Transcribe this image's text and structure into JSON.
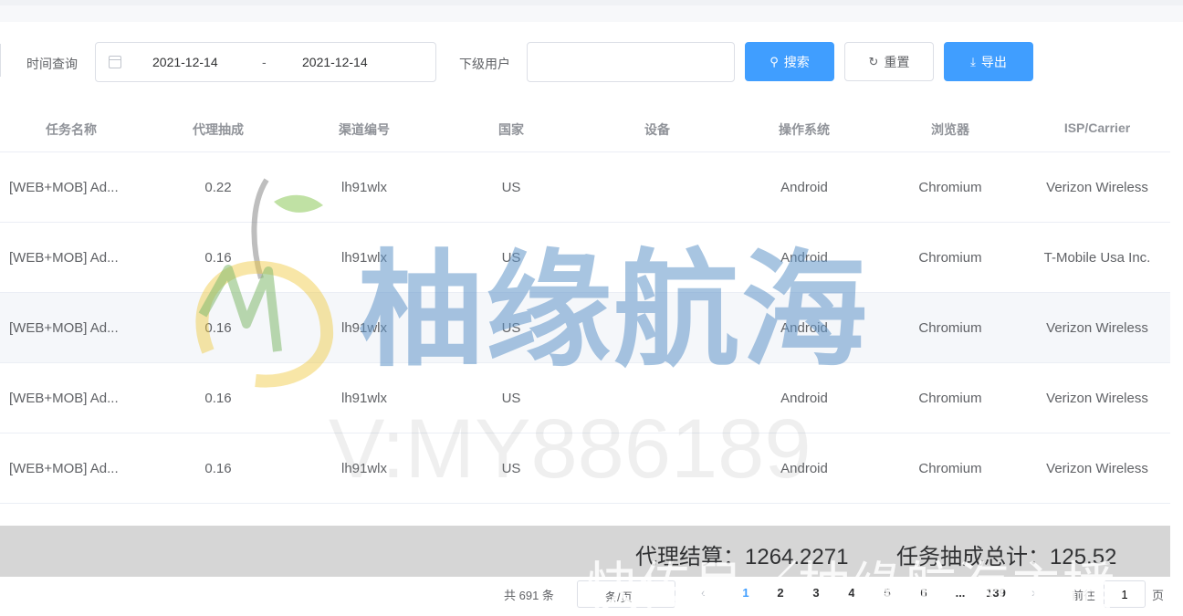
{
  "filters": {
    "time_label": "时间查询",
    "date_start": "2021-12-14",
    "date_sep": "-",
    "date_end": "2021-12-14",
    "subuser_label": "下级用户",
    "subuser_value": "",
    "search_label": "搜索",
    "reset_label": "重置",
    "export_label": "导出"
  },
  "table": {
    "columns": [
      "任务名称",
      "代理抽成",
      "渠道编号",
      "国家",
      "设备",
      "操作系统",
      "浏览器",
      "ISP/Carrier"
    ],
    "rows": [
      [
        "[WEB+MOB] Ad...",
        "0.22",
        "lh91wlx",
        "US",
        "",
        "Android",
        "Chromium",
        "Verizon Wireless"
      ],
      [
        "[WEB+MOB] Ad...",
        "0.16",
        "lh91wlx",
        "US",
        "",
        "Android",
        "Chromium",
        "T-Mobile Usa Inc."
      ],
      [
        "[WEB+MOB] Ad...",
        "0.16",
        "lh91wlx",
        "US",
        "",
        "Android",
        "Chromium",
        "Verizon Wireless"
      ],
      [
        "[WEB+MOB] Ad...",
        "0.16",
        "lh91wlx",
        "US",
        "",
        "Android",
        "Chromium",
        "Verizon Wireless"
      ],
      [
        "[WEB+MOB] Ad...",
        "0.16",
        "lh91wlx",
        "US",
        "",
        "Android",
        "Chromium",
        "Verizon Wireless"
      ]
    ]
  },
  "summary": {
    "agent_settlement": "代理结算：1264.2271",
    "task_commission_total": "任务抽成总计：125.52"
  },
  "pager": {
    "total": "共 691 条",
    "page_size": "条/页",
    "pages": [
      "1",
      "2",
      "3",
      "4",
      "5",
      "6",
      "...",
      "139"
    ],
    "active_page": "1",
    "goto_label": "前往",
    "goto_value": "1",
    "page_unit": "页"
  },
  "watermark": {
    "brand": "柚缘航海",
    "contact": "V:MY886189",
    "bottom": "快传号／柚缘航海主播"
  },
  "colors": {
    "primary": "#409eff",
    "header_text": "#909399",
    "summary_bg": "#d6d6d6"
  }
}
